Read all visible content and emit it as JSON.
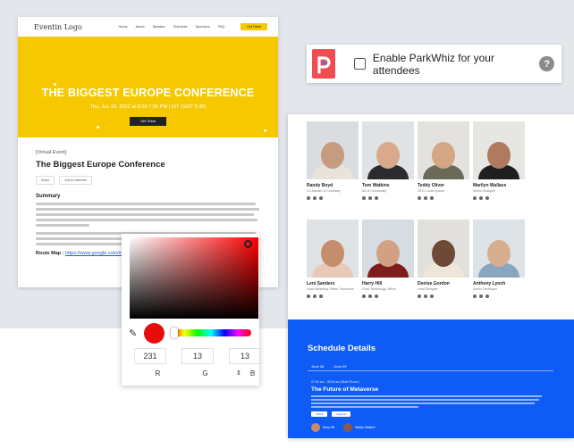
{
  "conference": {
    "logo": "Eventin Logo",
    "menu": [
      "Home",
      "About",
      "Speaker",
      "Schedule",
      "Sponsors",
      "FAQ"
    ],
    "nav_button": "Get Ticket",
    "hero_title": "THE BIGGEST EUROPE CONFERENCE",
    "hero_date": "Thu, Jun 29, 2022 at 8:03-7:00 PM | IST (GMT 5:30)",
    "hero_button": "Get Ticket",
    "meta": "[Virtual Event]",
    "title": "The Biggest Europe Conference",
    "share_label": "Share",
    "calendar_label": "Add to calendar",
    "summary_heading": "Summary",
    "route_label": "Route Map :",
    "route_link": "https://www.google.com/maps..."
  },
  "parkwhiz": {
    "label": "Enable ParkWhiz for your attendees",
    "help": "?",
    "logo_letter": "P"
  },
  "speakers": [
    {
      "name": "Randy Boyd",
      "role": "Co-founder of Company",
      "skin": "#c79b7d",
      "shirt": "#e9e3da"
    },
    {
      "name": "Tom Watkins",
      "role": "Art of Community",
      "skin": "#d8a98a",
      "shirt": "#2c2c30"
    },
    {
      "name": "Teddy Oliver",
      "role": "CEO, Lorem Ipsum",
      "skin": "#d4a684",
      "shirt": "#6b6a58"
    },
    {
      "name": "Marilyn Wallace",
      "role": "Senior Designer",
      "skin": "#b07a5e",
      "shirt": "#1f1f22"
    },
    {
      "name": "Leni Sanders",
      "role": "Lead Marketing Officer, Facebook",
      "skin": "#c48e6d",
      "shirt": "#e8c9b5"
    },
    {
      "name": "Harry Hill",
      "role": "Chief Technology Officer",
      "skin": "#d2a183",
      "shirt": "#7f1d1d"
    },
    {
      "name": "Denise Gordon",
      "role": "Lead Designer",
      "skin": "#6e4a36",
      "shirt": "#efe6d9"
    },
    {
      "name": "Anthony Lynch",
      "role": "Senior Developer",
      "skin": "#d8ae90",
      "shirt": "#88a6bf"
    }
  ],
  "schedule": {
    "heading": "Schedule Details",
    "tabs": [
      "June 28",
      "June 29"
    ],
    "time": "07:00 am - 08:00 am (Main Room)",
    "session_title": "The Future of Metaverse",
    "buttons": [
      "Virtual",
      "Keynote"
    ],
    "speakers": [
      "Harry Hill",
      "Marilyn Wallace"
    ]
  },
  "color_picker": {
    "r": "231",
    "g": "13",
    "b": "13",
    "label_r": "R",
    "label_g": "G",
    "label_b": "B",
    "swatch_color": "#e70d0d",
    "eyedropper_icon": "✎",
    "switch_icon": "⇕"
  }
}
